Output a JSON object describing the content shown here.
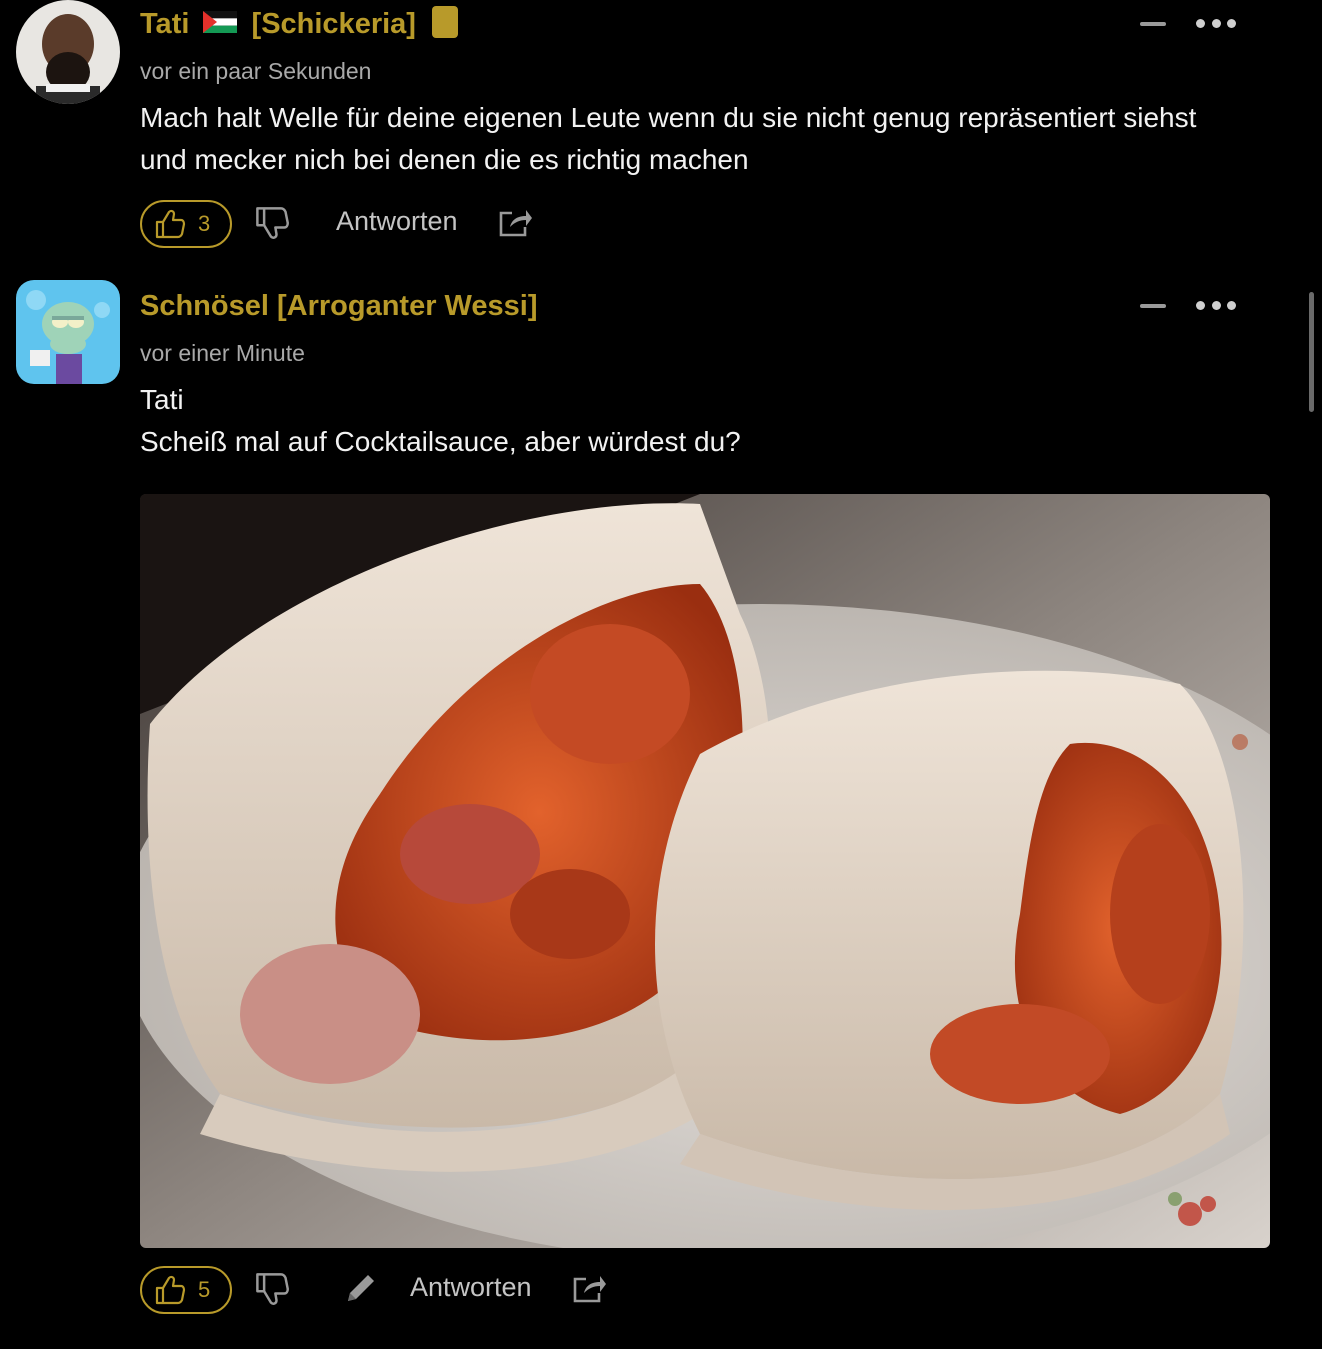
{
  "comments": [
    {
      "username_prefix": "Tati",
      "username_suffix": "[Schickeria]",
      "timestamp": "vor ein paar Sekunden",
      "body_lines": [
        "Mach halt Welle für deine eigenen Leute wenn du sie nicht genug repräsentiert siehst",
        "und mecker nich bei denen die es richtig machen"
      ],
      "like_count": "3",
      "reply_label": "Antworten"
    },
    {
      "username": "Schnösel [Arroganter Wessi]",
      "timestamp": "vor einer Minute",
      "body_lines": [
        "Tati",
        "Scheiß mal auf Cocktailsauce, aber würdest du?"
      ],
      "like_count": "5",
      "reply_label": "Antworten"
    }
  ],
  "colors": {
    "accent": "#b89a2a",
    "background": "#000000",
    "text": "#f2f2f2",
    "muted": "#a9a9a9"
  },
  "icons": [
    "collapse-icon",
    "more-icon",
    "thumbs-up-icon",
    "thumbs-down-icon",
    "share-icon",
    "pencil-icon",
    "flag-icon",
    "badge-icon"
  ]
}
